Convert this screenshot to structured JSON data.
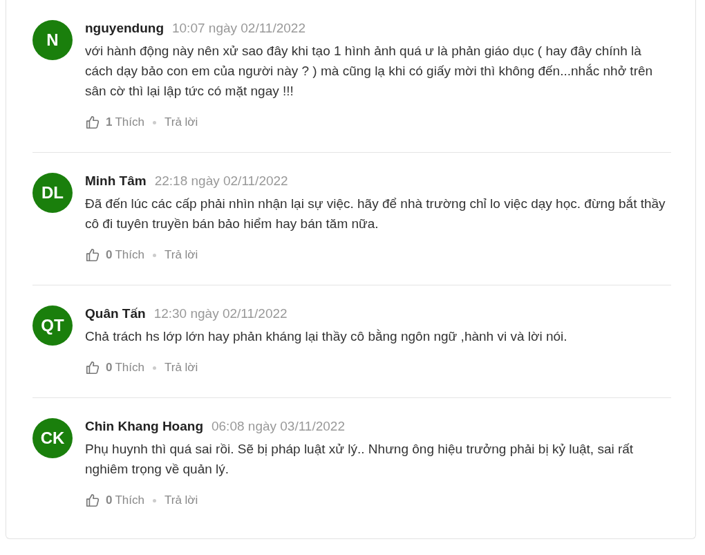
{
  "comments": [
    {
      "avatar": "N",
      "name": "nguyendung",
      "time": "10:07 ngày 02/11/2022",
      "body": "với hành động này nên xử sao đây khi tạo 1 hình ảnh quá ư là phản giáo dục ( hay đây chính là cách dạy bảo con em của người này ? ) mà cũng lạ khi có giấy mời thì không đến...nhắc nhở trên sân cờ thì lại lập tức có mặt ngay !!!",
      "likes": "1",
      "like_label": "Thích",
      "reply": "Trả lời"
    },
    {
      "avatar": "DL",
      "name": "Minh Tâm",
      "time": "22:18 ngày 02/11/2022",
      "body": "Đã đến lúc các cấp phải nhìn nhận lại sự việc. hãy để nhà trường chỉ lo việc dạy học. đừng bắt thầy cô đi tuyên truyền bán bảo hiểm hay bán tăm nữa.",
      "likes": "0",
      "like_label": "Thích",
      "reply": "Trả lời"
    },
    {
      "avatar": "QT",
      "name": "Quân Tấn",
      "time": "12:30 ngày 02/11/2022",
      "body": "Chả trách hs lớp lớn hay phản kháng lại thầy cô bằng ngôn ngữ ,hành vi và lời nói.",
      "likes": "0",
      "like_label": "Thích",
      "reply": "Trả lời"
    },
    {
      "avatar": "CK",
      "name": "Chin Khang Hoang",
      "time": "06:08 ngày 03/11/2022",
      "body": "Phụ huynh thì quá sai rồi. Sẽ bị pháp luật xử lý.. Nhưng ông hiệu trưởng phải bị kỷ luật, sai rất nghiêm trọng về quản lý.",
      "likes": "0",
      "like_label": "Thích",
      "reply": "Trả lời"
    }
  ]
}
